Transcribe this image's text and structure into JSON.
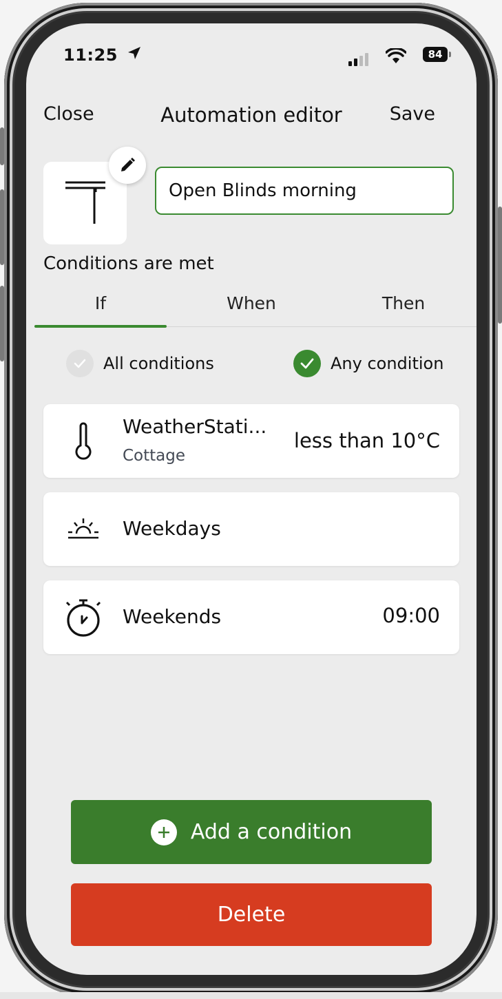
{
  "status_bar": {
    "time": "11:25",
    "battery": "84"
  },
  "nav": {
    "close_label": "Close",
    "title": "Automation editor",
    "save_label": "Save"
  },
  "automation": {
    "name": "Open Blinds morning",
    "icon": "blinds-icon"
  },
  "conditions_header": "Conditions are met",
  "tabs": [
    {
      "label": "If",
      "selected": true
    },
    {
      "label": "When",
      "selected": false
    },
    {
      "label": "Then",
      "selected": false
    }
  ],
  "match_mode": {
    "all_label": "All conditions",
    "any_label": "Any condition",
    "selected": "any"
  },
  "conditions": [
    {
      "icon": "thermometer-icon",
      "title": "WeatherStati...",
      "subtitle": "Cottage",
      "value": "less than 10°C"
    },
    {
      "icon": "sunrise-icon",
      "title": "Weekdays",
      "subtitle": "",
      "value": ""
    },
    {
      "icon": "stopwatch-icon",
      "title": "Weekends",
      "subtitle": "",
      "value": "09:00"
    }
  ],
  "buttons": {
    "add_label": "Add a condition",
    "delete_label": "Delete"
  },
  "colors": {
    "accent_green": "#3a7d2c",
    "delete_red": "#d63c20",
    "background": "#ececec"
  }
}
